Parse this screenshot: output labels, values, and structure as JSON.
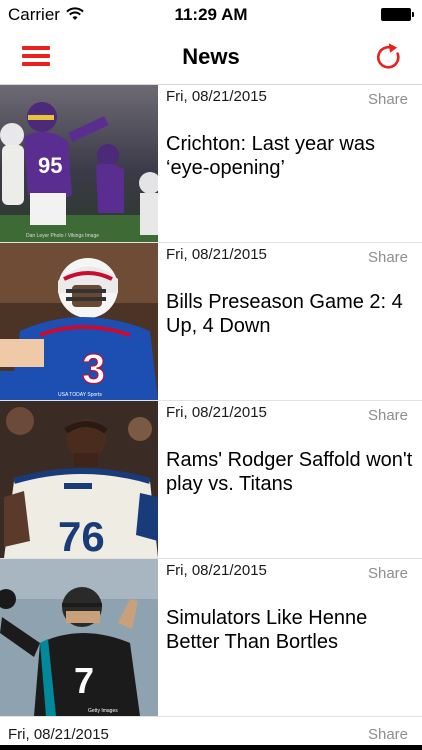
{
  "status_bar": {
    "carrier": "Carrier",
    "time": "11:29 AM",
    "wifi_icon": "wifi-icon",
    "battery_icon": "battery-icon"
  },
  "navbar": {
    "title": "News",
    "menu_icon": "hamburger-menu-icon",
    "refresh_icon": "refresh-icon",
    "accent_color": "#e8211e"
  },
  "news": [
    {
      "date": "Fri, 08/21/2015",
      "share_label": "Share",
      "title": "Crichton: Last year was ‘eye-opening’",
      "photo_credit": "Dan Leyer Photo / Vikings Image"
    },
    {
      "date": "Fri, 08/21/2015",
      "share_label": "Share",
      "title": "Bills Preseason Game 2: 4 Up, 4 Down",
      "photo_credit": "USA TODAY Sports"
    },
    {
      "date": "Fri, 08/21/2015",
      "share_label": "Share",
      "title": "Rams' Rodger Saffold won't play vs. Titans"
    },
    {
      "date": "Fri, 08/21/2015",
      "share_label": "Share",
      "title": "Simulators Like Henne Better Than Bortles",
      "photo_credit": "Getty Images"
    },
    {
      "date": "Fri, 08/21/2015",
      "share_label": "Share"
    }
  ]
}
